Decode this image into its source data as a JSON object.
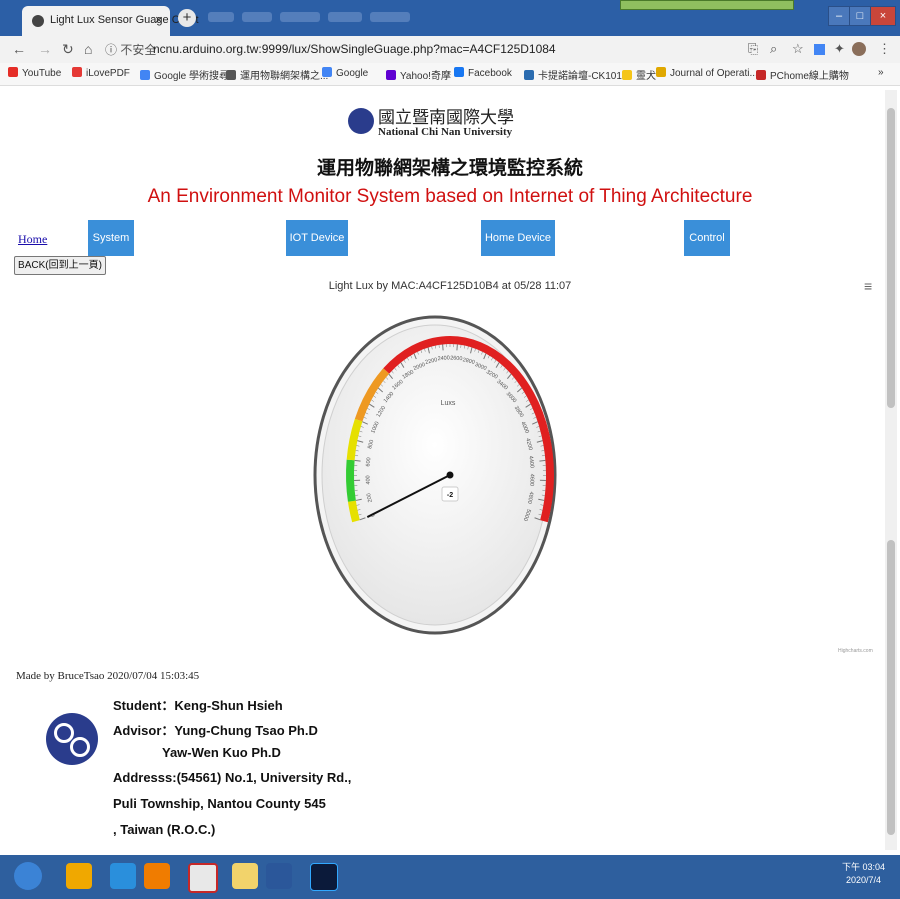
{
  "browser": {
    "tab_title": "Light Lux Sensor Guage Chart",
    "tab_close": "×",
    "new_tab": "+",
    "url_security": "ⓘ 不安全",
    "url": "ncnu.arduino.org.tw:9999/lux/ShowSingleGuage.php?mac=A4CF125D1084",
    "bookmarks": [
      {
        "label": "YouTube",
        "color": "#e52d27"
      },
      {
        "label": "iLovePDF",
        "color": "#e53935"
      },
      {
        "label": "Google 學術搜尋",
        "color": "#4285f4"
      },
      {
        "label": "運用物聯網架構之...",
        "color": "#555555"
      },
      {
        "label": "Google",
        "color": "#4285f4"
      },
      {
        "label": "Yahoo!奇摩",
        "color": "#6001d2"
      },
      {
        "label": "Facebook",
        "color": "#1877f2"
      },
      {
        "label": "卡提諾論壇-CK101...",
        "color": "#2b6cb0"
      },
      {
        "label": "靈犬",
        "color": "#f5c518"
      },
      {
        "label": "Journal of Operati...",
        "color": "#e0a800"
      },
      {
        "label": "PChome線上購物",
        "color": "#c62828"
      }
    ],
    "bookmarks_more": "»"
  },
  "header": {
    "university_zh": "國立暨南國際大學",
    "university_en": "National Chi Nan University",
    "system_zh": "運用物聯網架構之環境監控系統",
    "system_en": "An Environment Monitor System based on Internet of Thing Architecture"
  },
  "nav": {
    "home": "Home",
    "buttons": [
      "System",
      "IOT Device",
      "Home Device",
      "Control"
    ],
    "back": "BACK(回到上一頁)"
  },
  "gauge": {
    "title": "Light Lux by MAC:A4CF125D10B4 at 05/28 11:07",
    "unit_label": "Luxs",
    "value": -2,
    "value_label": "-2",
    "min": 0,
    "max": 5000,
    "ticks": [
      "0",
      "200",
      "400",
      "600",
      "800",
      "1000",
      "1200",
      "1400",
      "1600",
      "1800",
      "2000",
      "2200",
      "2400",
      "2600",
      "2800",
      "3000",
      "3200",
      "3400",
      "3600",
      "3800",
      "4000",
      "4200",
      "4400",
      "4600",
      "4800",
      "5000"
    ],
    "bands": [
      {
        "from": 0,
        "to": 200,
        "color": "#e6e000"
      },
      {
        "from": 200,
        "to": 600,
        "color": "#33cc33"
      },
      {
        "from": 600,
        "to": 1000,
        "color": "#e6e000"
      },
      {
        "from": 1000,
        "to": 1600,
        "color": "#ee9922"
      },
      {
        "from": 1600,
        "to": 5000,
        "color": "#e02020"
      }
    ],
    "credits": "Highcharts.com"
  },
  "footer": {
    "made_by": "Made by BruceTsao 2020/07/04 15:03:45",
    "lines": [
      "Student：Keng-Shun Hsieh",
      "Advisor：Yung-Chung Tsao Ph.D",
      "Yaw-Wen Kuo  Ph.D",
      "Addresss:(54561) No.1, University Rd.,",
      "Puli Township, Nantou County 545",
      ", Taiwan (R.O.C.)"
    ]
  },
  "taskbar": {
    "time": "下午 03:04",
    "date": "2020/7/4"
  }
}
